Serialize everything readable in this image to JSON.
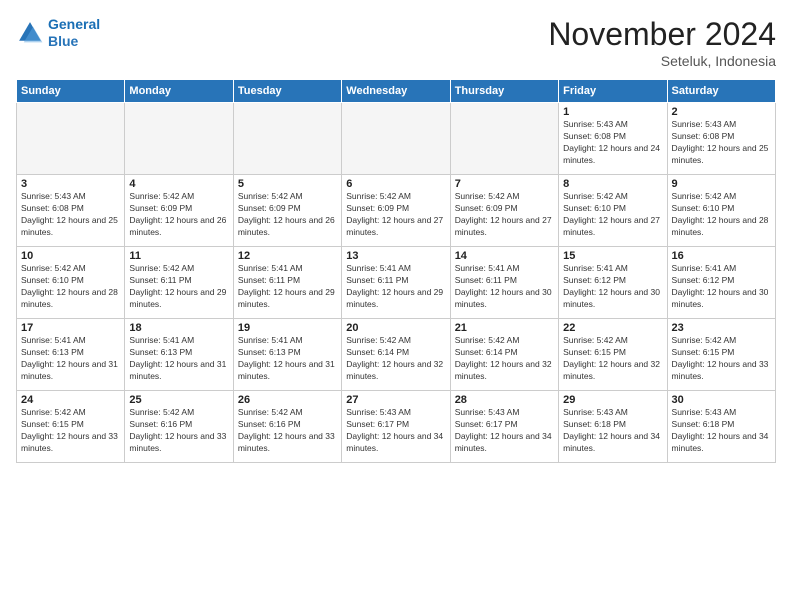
{
  "logo": {
    "line1": "General",
    "line2": "Blue"
  },
  "title": "November 2024",
  "location": "Seteluk, Indonesia",
  "days_of_week": [
    "Sunday",
    "Monday",
    "Tuesday",
    "Wednesday",
    "Thursday",
    "Friday",
    "Saturday"
  ],
  "weeks": [
    [
      {
        "day": "",
        "info": ""
      },
      {
        "day": "",
        "info": ""
      },
      {
        "day": "",
        "info": ""
      },
      {
        "day": "",
        "info": ""
      },
      {
        "day": "",
        "info": ""
      },
      {
        "day": "1",
        "info": "Sunrise: 5:43 AM\nSunset: 6:08 PM\nDaylight: 12 hours and 24 minutes."
      },
      {
        "day": "2",
        "info": "Sunrise: 5:43 AM\nSunset: 6:08 PM\nDaylight: 12 hours and 25 minutes."
      }
    ],
    [
      {
        "day": "3",
        "info": "Sunrise: 5:43 AM\nSunset: 6:08 PM\nDaylight: 12 hours and 25 minutes."
      },
      {
        "day": "4",
        "info": "Sunrise: 5:42 AM\nSunset: 6:09 PM\nDaylight: 12 hours and 26 minutes."
      },
      {
        "day": "5",
        "info": "Sunrise: 5:42 AM\nSunset: 6:09 PM\nDaylight: 12 hours and 26 minutes."
      },
      {
        "day": "6",
        "info": "Sunrise: 5:42 AM\nSunset: 6:09 PM\nDaylight: 12 hours and 27 minutes."
      },
      {
        "day": "7",
        "info": "Sunrise: 5:42 AM\nSunset: 6:09 PM\nDaylight: 12 hours and 27 minutes."
      },
      {
        "day": "8",
        "info": "Sunrise: 5:42 AM\nSunset: 6:10 PM\nDaylight: 12 hours and 27 minutes."
      },
      {
        "day": "9",
        "info": "Sunrise: 5:42 AM\nSunset: 6:10 PM\nDaylight: 12 hours and 28 minutes."
      }
    ],
    [
      {
        "day": "10",
        "info": "Sunrise: 5:42 AM\nSunset: 6:10 PM\nDaylight: 12 hours and 28 minutes."
      },
      {
        "day": "11",
        "info": "Sunrise: 5:42 AM\nSunset: 6:11 PM\nDaylight: 12 hours and 29 minutes."
      },
      {
        "day": "12",
        "info": "Sunrise: 5:41 AM\nSunset: 6:11 PM\nDaylight: 12 hours and 29 minutes."
      },
      {
        "day": "13",
        "info": "Sunrise: 5:41 AM\nSunset: 6:11 PM\nDaylight: 12 hours and 29 minutes."
      },
      {
        "day": "14",
        "info": "Sunrise: 5:41 AM\nSunset: 6:11 PM\nDaylight: 12 hours and 30 minutes."
      },
      {
        "day": "15",
        "info": "Sunrise: 5:41 AM\nSunset: 6:12 PM\nDaylight: 12 hours and 30 minutes."
      },
      {
        "day": "16",
        "info": "Sunrise: 5:41 AM\nSunset: 6:12 PM\nDaylight: 12 hours and 30 minutes."
      }
    ],
    [
      {
        "day": "17",
        "info": "Sunrise: 5:41 AM\nSunset: 6:13 PM\nDaylight: 12 hours and 31 minutes."
      },
      {
        "day": "18",
        "info": "Sunrise: 5:41 AM\nSunset: 6:13 PM\nDaylight: 12 hours and 31 minutes."
      },
      {
        "day": "19",
        "info": "Sunrise: 5:41 AM\nSunset: 6:13 PM\nDaylight: 12 hours and 31 minutes."
      },
      {
        "day": "20",
        "info": "Sunrise: 5:42 AM\nSunset: 6:14 PM\nDaylight: 12 hours and 32 minutes."
      },
      {
        "day": "21",
        "info": "Sunrise: 5:42 AM\nSunset: 6:14 PM\nDaylight: 12 hours and 32 minutes."
      },
      {
        "day": "22",
        "info": "Sunrise: 5:42 AM\nSunset: 6:15 PM\nDaylight: 12 hours and 32 minutes."
      },
      {
        "day": "23",
        "info": "Sunrise: 5:42 AM\nSunset: 6:15 PM\nDaylight: 12 hours and 33 minutes."
      }
    ],
    [
      {
        "day": "24",
        "info": "Sunrise: 5:42 AM\nSunset: 6:15 PM\nDaylight: 12 hours and 33 minutes."
      },
      {
        "day": "25",
        "info": "Sunrise: 5:42 AM\nSunset: 6:16 PM\nDaylight: 12 hours and 33 minutes."
      },
      {
        "day": "26",
        "info": "Sunrise: 5:42 AM\nSunset: 6:16 PM\nDaylight: 12 hours and 33 minutes."
      },
      {
        "day": "27",
        "info": "Sunrise: 5:43 AM\nSunset: 6:17 PM\nDaylight: 12 hours and 34 minutes."
      },
      {
        "day": "28",
        "info": "Sunrise: 5:43 AM\nSunset: 6:17 PM\nDaylight: 12 hours and 34 minutes."
      },
      {
        "day": "29",
        "info": "Sunrise: 5:43 AM\nSunset: 6:18 PM\nDaylight: 12 hours and 34 minutes."
      },
      {
        "day": "30",
        "info": "Sunrise: 5:43 AM\nSunset: 6:18 PM\nDaylight: 12 hours and 34 minutes."
      }
    ]
  ]
}
